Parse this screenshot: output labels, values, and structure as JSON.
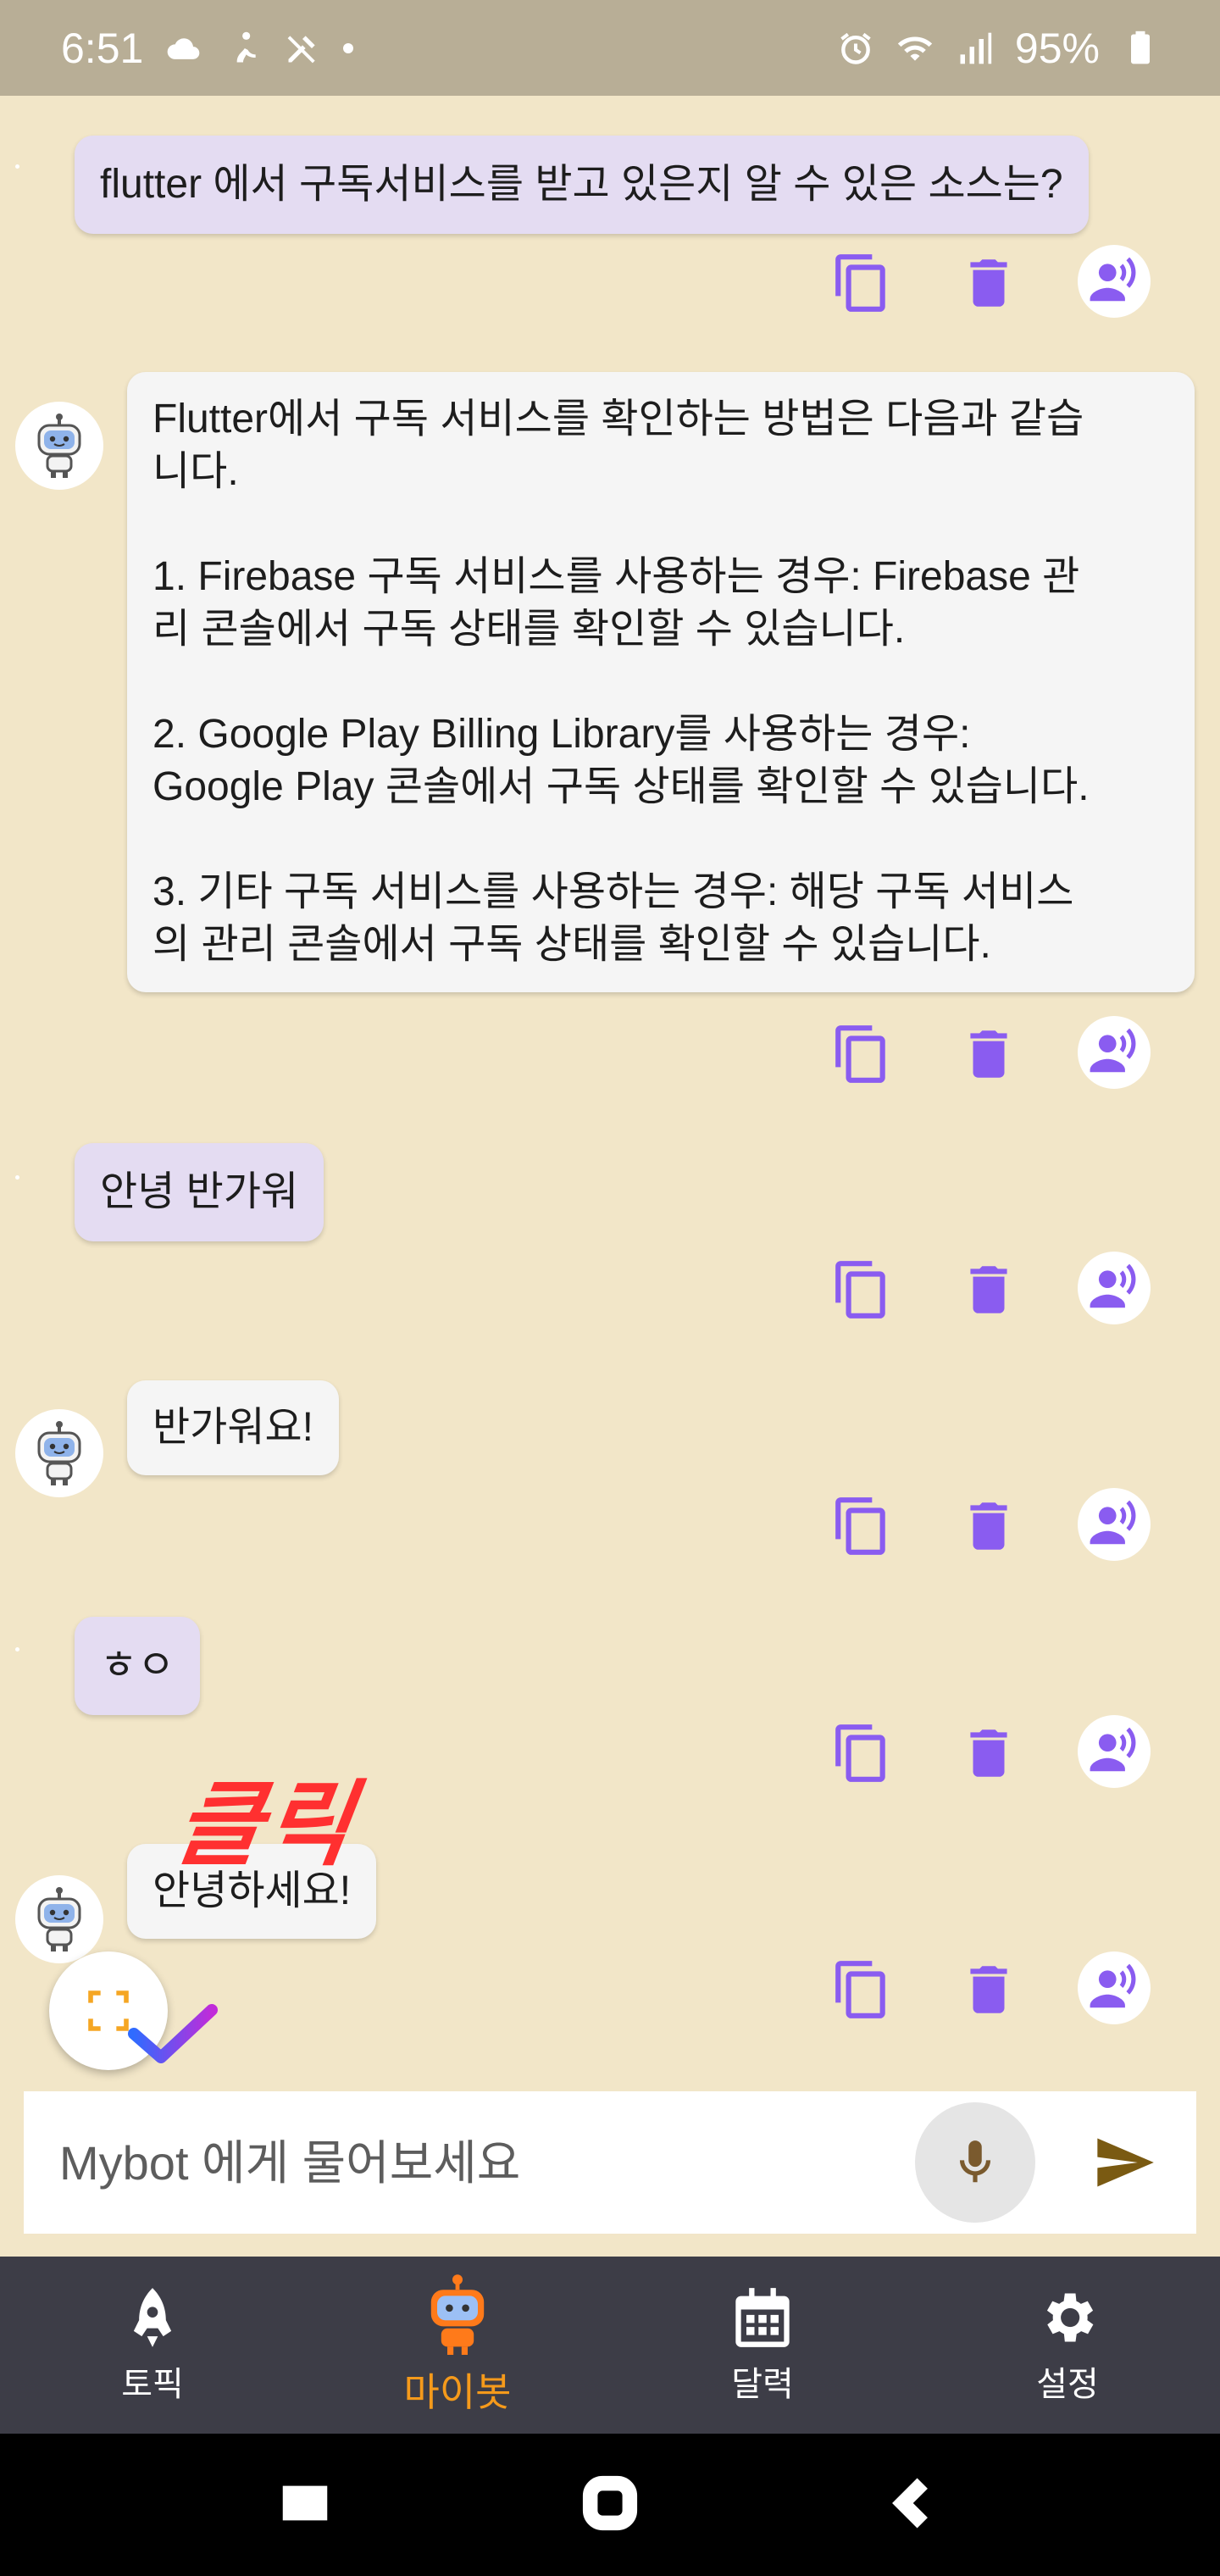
{
  "status_bar": {
    "time": "6:51",
    "battery": "95%"
  },
  "messages": [
    {
      "role": "user",
      "text": "flutter 에서 구독서비스를 받고 있은지 알 수 있은 소스는?"
    },
    {
      "role": "bot",
      "text": "Flutter에서 구독 서비스를 확인하는 방법은 다음과 같습\n니다.\n\n1. Firebase 구독 서비스를 사용하는 경우: Firebase 관\n리 콘솔에서 구독 상태를 확인할 수 있습니다.\n\n2. Google Play Billing Library를 사용하는 경우:\nGoogle Play 콘솔에서 구독 상태를 확인할 수 있습니다.\n\n3. 기타 구독 서비스를 사용하는 경우: 해당 구독 서비스\n의 관리 콘솔에서 구독 상태를 확인할 수 있습니다."
    },
    {
      "role": "user",
      "text": "안녕 반가워"
    },
    {
      "role": "bot",
      "text": "반가워요!"
    },
    {
      "role": "user",
      "text": "ㅎㅇ"
    },
    {
      "role": "bot",
      "text": "안녕하세요!"
    }
  ],
  "annotation": "클릭",
  "input": {
    "placeholder": "Mybot 에게 물어보세요"
  },
  "bottom_nav": [
    {
      "label": "토픽",
      "icon": "rocket-icon"
    },
    {
      "label": "마이봇",
      "icon": "robot-icon",
      "active": true
    },
    {
      "label": "달력",
      "icon": "calendar-icon"
    },
    {
      "label": "설정",
      "icon": "gear-icon"
    }
  ],
  "colors": {
    "background": "#f2e6c8",
    "user_bubble": "#e4dcf2",
    "bot_bubble": "#f5f5f5",
    "action_icon": "#8a5cf0",
    "nav_active": "#f59a1b",
    "nav_bg": "#3d3d47"
  }
}
